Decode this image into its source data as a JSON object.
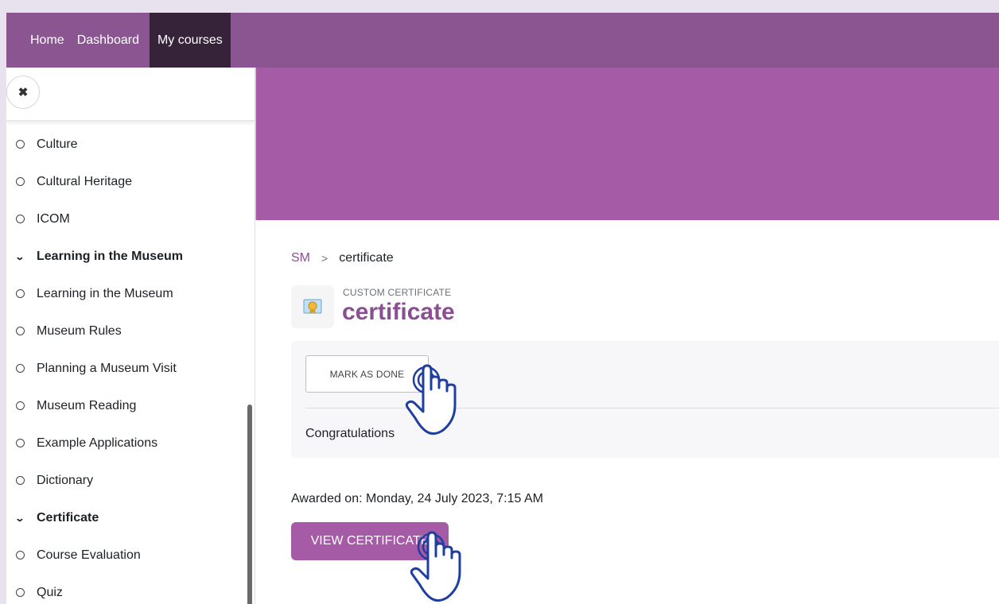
{
  "nav": {
    "items": [
      {
        "label": "Home"
      },
      {
        "label": "Dashboard"
      },
      {
        "label": "My courses"
      }
    ]
  },
  "sidebar": {
    "close_icon": "close-icon",
    "items": [
      {
        "label": "Culture",
        "type": "activity"
      },
      {
        "label": "Cultural Heritage",
        "type": "activity"
      },
      {
        "label": "ICOM",
        "type": "activity"
      },
      {
        "label": "Learning in the Museum",
        "type": "section"
      },
      {
        "label": "Learning in the Museum",
        "type": "activity"
      },
      {
        "label": "Museum Rules",
        "type": "activity"
      },
      {
        "label": "Planning a Museum Visit",
        "type": "activity"
      },
      {
        "label": "Museum Reading",
        "type": "activity"
      },
      {
        "label": "Example Applications",
        "type": "activity"
      },
      {
        "label": "Dictionary",
        "type": "activity"
      },
      {
        "label": "Certificate",
        "type": "section"
      },
      {
        "label": "Course Evaluation",
        "type": "activity"
      },
      {
        "label": "Quiz",
        "type": "activity"
      }
    ]
  },
  "breadcrumb": {
    "course": "SM",
    "separator": ">",
    "current": "certificate"
  },
  "activity": {
    "type_label": "CUSTOM CERTIFICATE",
    "title": "certificate",
    "icon": "certificate-icon"
  },
  "completion": {
    "mark_done_label": "MARK AS DONE",
    "message": "Congratulations"
  },
  "awarded_text": "Awarded on: Monday, 24 July 2023, 7:15 AM",
  "view_certificate_label": "VIEW CERTIFICATE",
  "colors": {
    "navbar": "#8a5590",
    "nav_active": "#36233a",
    "banner": "#a55ba5",
    "brand_text": "#8a4f90",
    "primary_button": "#a55ba5",
    "hand_pointer": "#1f3fa0"
  }
}
